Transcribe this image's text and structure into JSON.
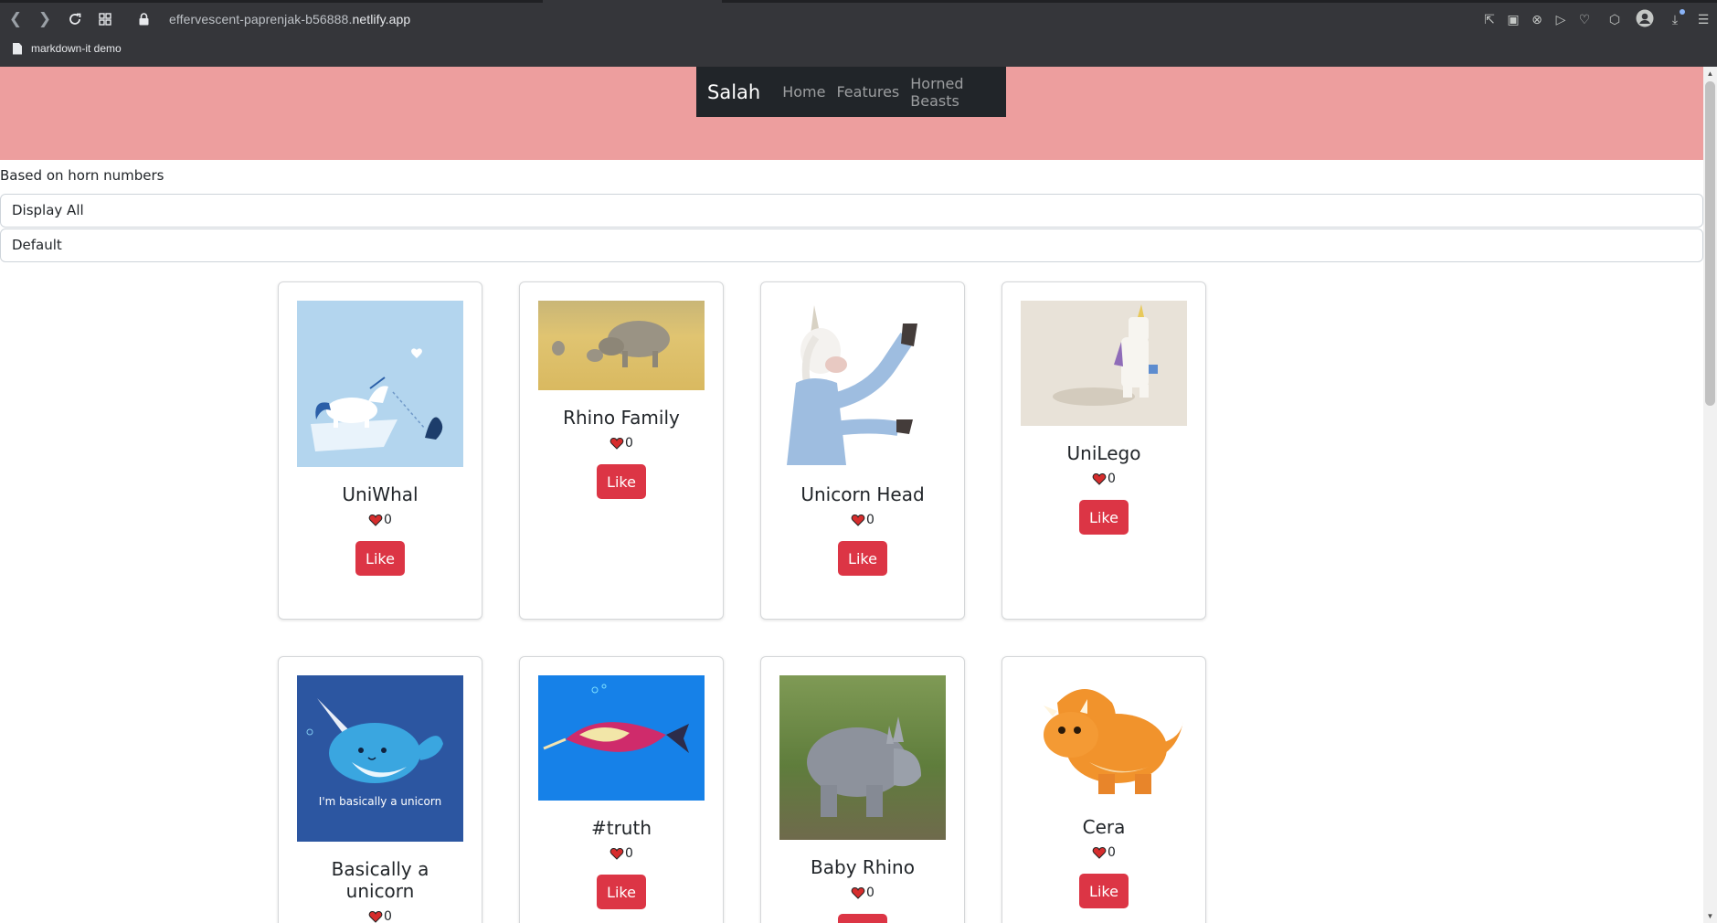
{
  "browser": {
    "url_prefix": "effervescent-paprenjak-b56888.",
    "url_domain": "netlify.app",
    "bookmark_label": "markdown-it demo"
  },
  "navbar": {
    "brand": "Salah",
    "links": [
      "Home",
      "Features",
      "Horned Beasts"
    ]
  },
  "filter": {
    "label": "Based on horn numbers",
    "select_value": "Display All",
    "sort_value": "Default"
  },
  "like_label": "Like",
  "cards": [
    {
      "title": "UniWhal",
      "likes": "0",
      "image": "unicorn-narwhal-illustration"
    },
    {
      "title": "Rhino Family",
      "likes": "0",
      "image": "rhino-family-photo"
    },
    {
      "title": "Unicorn Head",
      "likes": "0",
      "image": "unicorn-mask-person"
    },
    {
      "title": "UniLego",
      "likes": "0",
      "image": "lego-unicorn-toy"
    },
    {
      "title": "Basically a unicorn",
      "likes": "0",
      "image": "narwhal-cartoon",
      "image_text": "I'm basically a unicorn"
    },
    {
      "title": "#truth",
      "likes": "0",
      "image": "narwhal-unicorn-art"
    },
    {
      "title": "Baby Rhino",
      "likes": "0",
      "image": "baby-rhino-photo"
    },
    {
      "title": "Cera",
      "likes": "0",
      "image": "triceratops-cartoon"
    }
  ],
  "colors": {
    "hero": "#ed9e9e",
    "navbar": "#212529",
    "like_button": "#dc3545"
  }
}
